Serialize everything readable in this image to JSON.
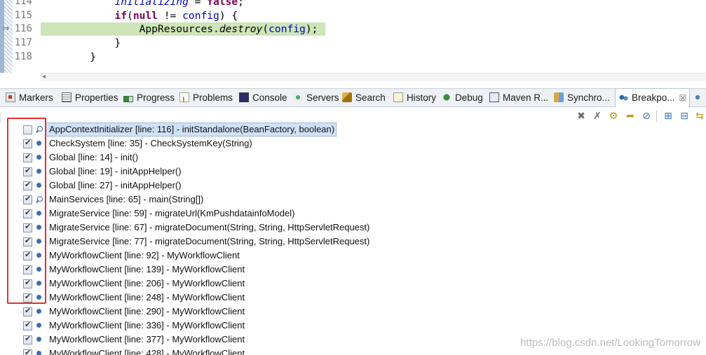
{
  "editor": {
    "lines": [
      {
        "number": "114",
        "segments": [
          {
            "text": "            ",
            "cls": ""
          },
          {
            "text": "initializing",
            "cls": "fld static-m"
          },
          {
            "text": " = ",
            "cls": ""
          },
          {
            "text": "false",
            "cls": "kw"
          },
          {
            "text": ";",
            "cls": ""
          }
        ],
        "current": false
      },
      {
        "number": "115",
        "segments": [
          {
            "text": "            ",
            "cls": ""
          },
          {
            "text": "if",
            "cls": "kw"
          },
          {
            "text": "(",
            "cls": ""
          },
          {
            "text": "null",
            "cls": "kw"
          },
          {
            "text": " != ",
            "cls": ""
          },
          {
            "text": "config",
            "cls": "fld"
          },
          {
            "text": ") {",
            "cls": ""
          }
        ],
        "current": false
      },
      {
        "number": "116",
        "segments": [
          {
            "text": "                AppResources.",
            "cls": ""
          },
          {
            "text": "destroy",
            "cls": "static-m"
          },
          {
            "text": "(",
            "cls": ""
          },
          {
            "text": "config",
            "cls": "fld"
          },
          {
            "text": ");",
            "cls": ""
          }
        ],
        "current": true
      },
      {
        "number": "117",
        "segments": [
          {
            "text": "            }",
            "cls": ""
          }
        ],
        "current": false
      },
      {
        "number": "118",
        "segments": [
          {
            "text": "        }",
            "cls": ""
          }
        ],
        "current": false
      }
    ]
  },
  "tabs": [
    {
      "label": "Markers",
      "icon": "markers-icon"
    },
    {
      "label": "Properties",
      "icon": "properties-icon"
    },
    {
      "label": "Progress",
      "icon": "progress-icon"
    },
    {
      "label": "Problems",
      "icon": "problems-icon"
    },
    {
      "label": "Console",
      "icon": "console-icon"
    },
    {
      "label": "Servers",
      "icon": "servers-icon"
    },
    {
      "label": "Search",
      "icon": "search-icon"
    },
    {
      "label": "History",
      "icon": "history-icon"
    },
    {
      "label": "Debug",
      "icon": "debug-icon"
    },
    {
      "label": "Maven R...",
      "icon": "maven-icon"
    },
    {
      "label": "Synchro...",
      "icon": "synchronize-icon"
    },
    {
      "label": "Breakpo...",
      "icon": "breakpoints-icon",
      "active": true,
      "close": "☒"
    }
  ],
  "toolbar": {
    "buttons": [
      "remove-breakpoint-icon",
      "remove-all-breakpoints-icon",
      "show-supported-breakpoints-icon",
      "go-to-file-icon",
      "skip-all-breakpoints-icon",
      "expand-all-icon",
      "collapse-all-icon",
      "link-with-debug-view-icon"
    ]
  },
  "breakpoints": [
    {
      "label": "AppContextInitializer [line: 116] - initStandalone(BeanFactory, boolean)",
      "checked": false,
      "conditional": true,
      "selected": true
    },
    {
      "label": "CheckSystem [line: 35] - CheckSystemKey(String)",
      "checked": true,
      "conditional": false
    },
    {
      "label": "Global [line: 14] - init()",
      "checked": true,
      "conditional": false
    },
    {
      "label": "Global [line: 19] - initAppHelper()",
      "checked": true,
      "conditional": false
    },
    {
      "label": "Global [line: 27] - initAppHelper()",
      "checked": true,
      "conditional": false
    },
    {
      "label": "MainServices [line: 65] - main(String[])",
      "checked": true,
      "conditional": true
    },
    {
      "label": "MigrateService [line: 59] - migrateUrl(KmPushdatainfoModel)",
      "checked": true,
      "conditional": false
    },
    {
      "label": "MigrateService [line: 67] - migrateDocument(String, String, HttpServletRequest)",
      "checked": true,
      "conditional": false
    },
    {
      "label": "MigrateService [line: 77] - migrateDocument(String, String, HttpServletRequest)",
      "checked": true,
      "conditional": false
    },
    {
      "label": "MyWorkflowClient [line: 92] - MyWorkflowClient",
      "checked": true,
      "conditional": false
    },
    {
      "label": "MyWorkflowClient [line: 139] - MyWorkflowClient",
      "checked": true,
      "conditional": false
    },
    {
      "label": "MyWorkflowClient [line: 206] - MyWorkflowClient",
      "checked": true,
      "conditional": false
    },
    {
      "label": "MyWorkflowClient [line: 248] - MyWorkflowClient",
      "checked": true,
      "conditional": false
    },
    {
      "label": "MyWorkflowClient [line: 290] - MyWorkflowClient",
      "checked": true,
      "conditional": false
    },
    {
      "label": "MyWorkflowClient [line: 336] - MyWorkflowClient",
      "checked": true,
      "conditional": false
    },
    {
      "label": "MyWorkflowClient [line: 377] - MyWorkflowClient",
      "checked": true,
      "conditional": false
    },
    {
      "label": "MyWorkflowClient [line: 428] - MyWorkflowClient",
      "checked": true,
      "conditional": false
    }
  ],
  "watermark": "https://blog.csdn.net/LookingTomorrow"
}
